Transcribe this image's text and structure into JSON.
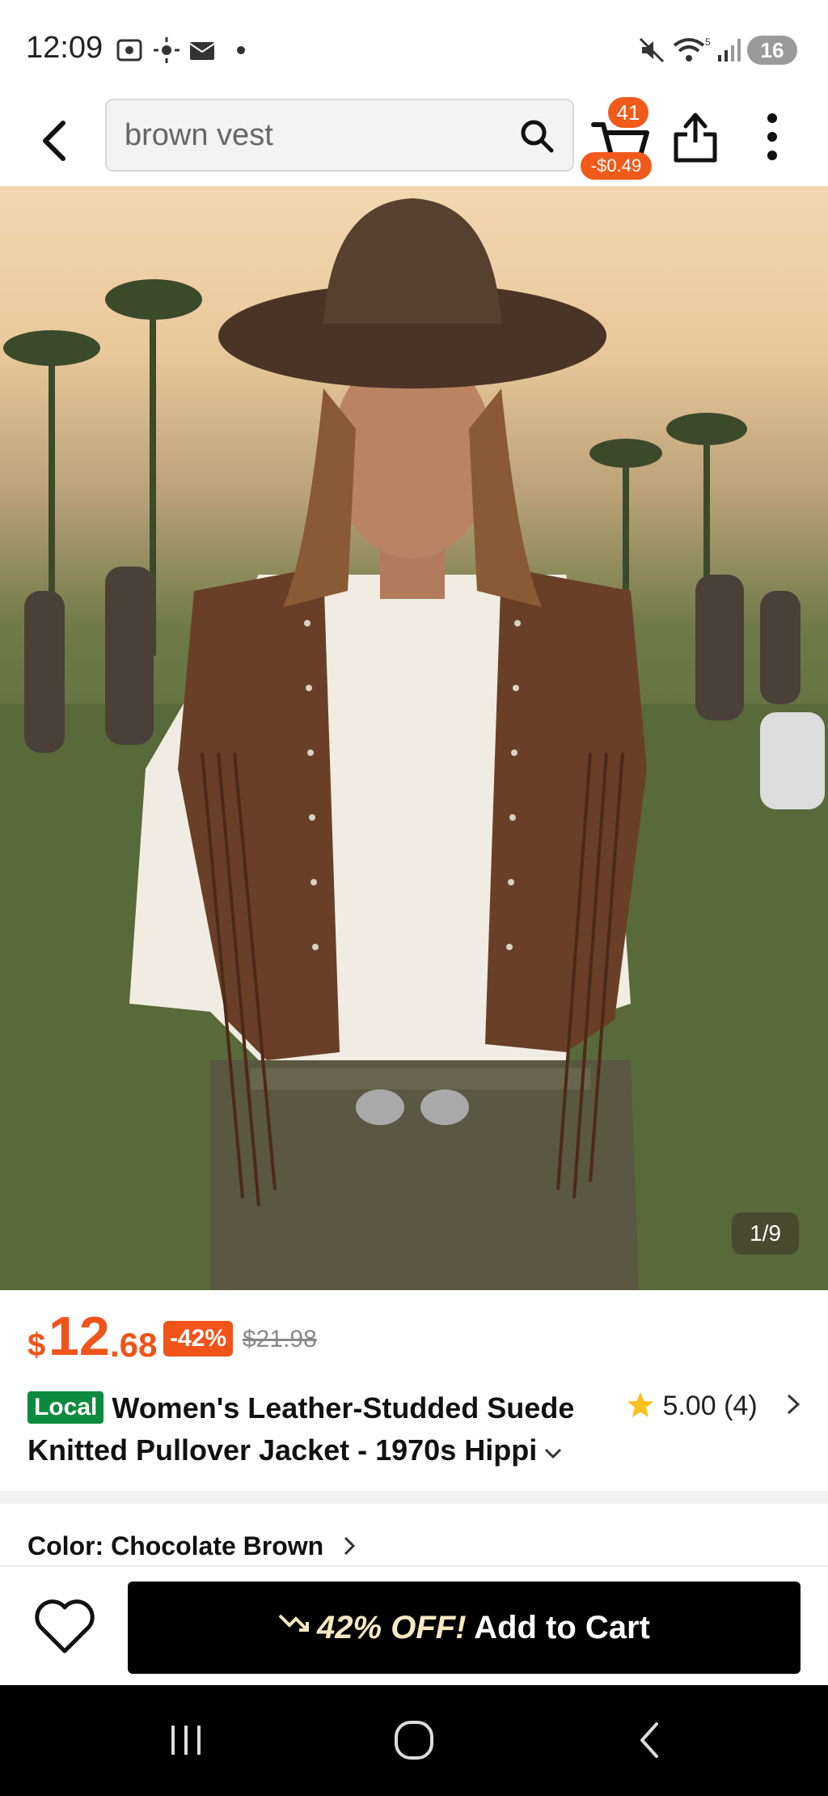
{
  "status_bar": {
    "time": "12:09",
    "battery": "16"
  },
  "search": {
    "query": "brown vest"
  },
  "cart": {
    "count": "41",
    "discount": "-$0.49"
  },
  "hero": {
    "counter": "1/9"
  },
  "price": {
    "symbol": "$",
    "integer": "12",
    "decimal": ".68",
    "discount": "-42%",
    "original": "$21.98"
  },
  "product": {
    "tag": "Local",
    "title": "Women's Leather-Studded Suede Knitted Pullover Jacket - 1970s Hippi",
    "rating": "5.00",
    "reviews": "(4)"
  },
  "color": {
    "label": "Color: Chocolate Brown"
  },
  "action": {
    "off_label": "42% OFF!",
    "add_label": "Add to Cart"
  },
  "colors": {
    "accent": "#f0541a",
    "local_green": "#0c8a3e",
    "button_black": "#000000"
  }
}
